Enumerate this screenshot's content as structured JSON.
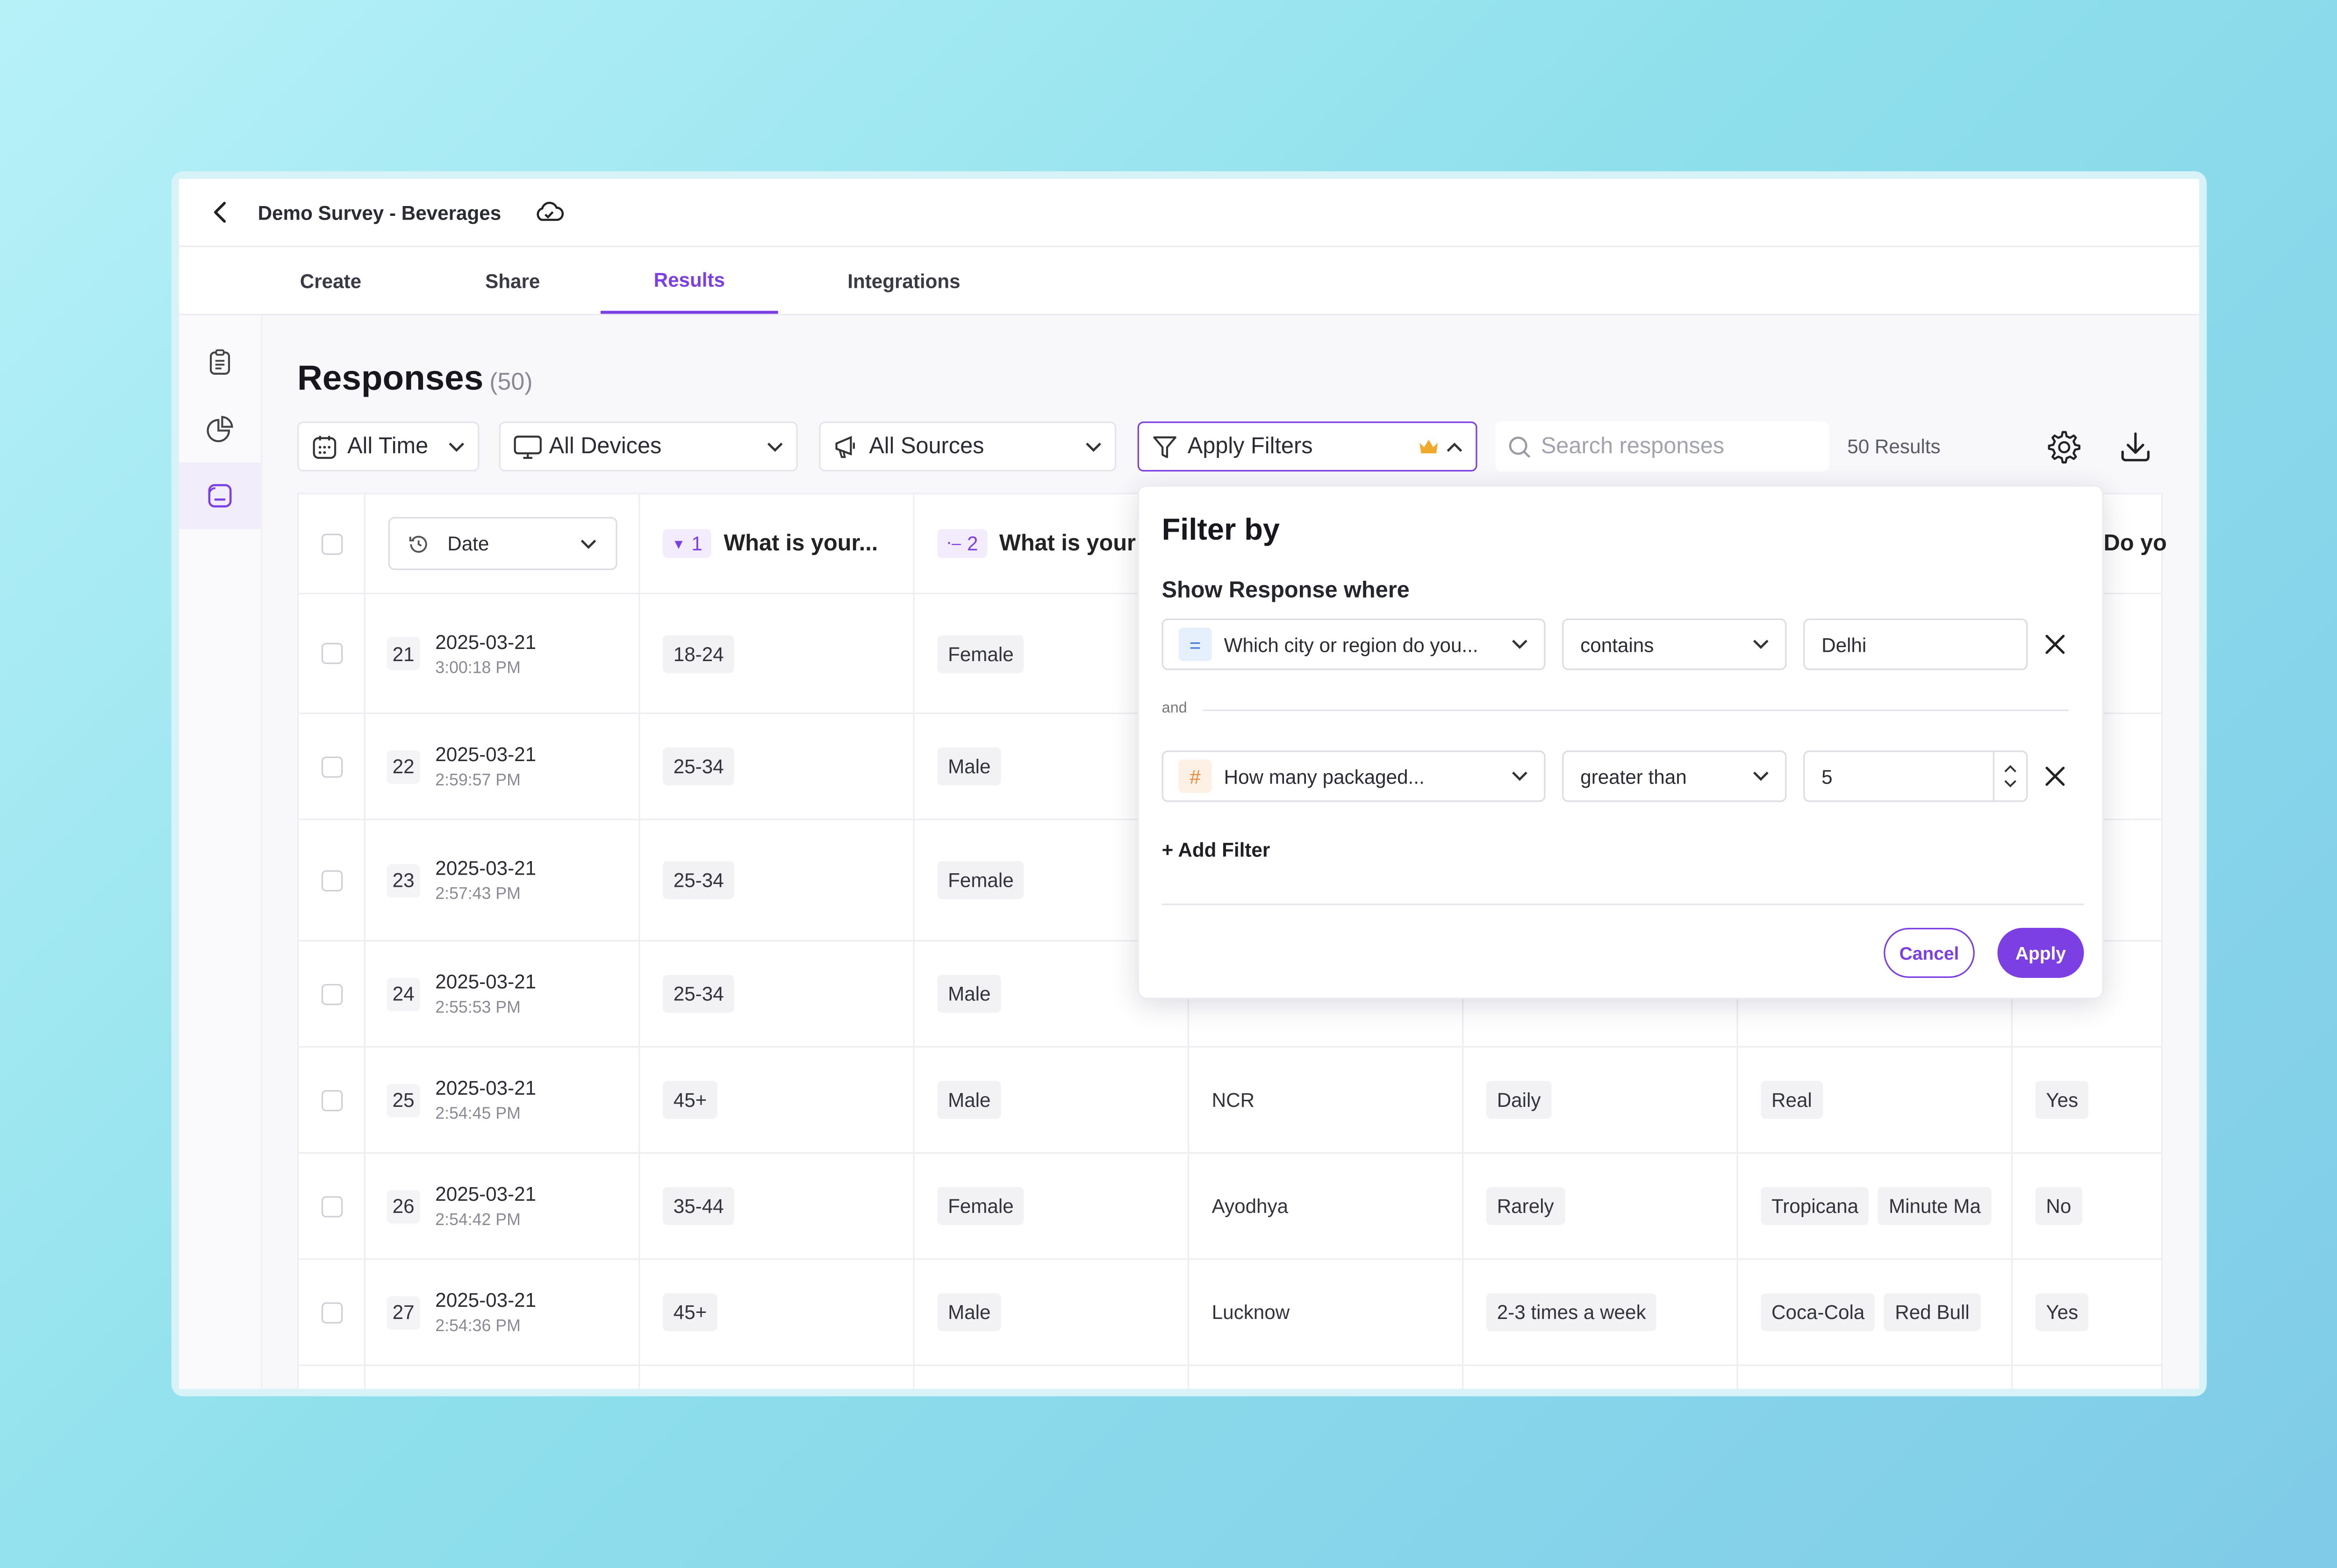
{
  "header": {
    "title": "Demo Survey - Beverages"
  },
  "tabs": [
    {
      "label": "Create"
    },
    {
      "label": "Share"
    },
    {
      "label": "Results"
    },
    {
      "label": "Integrations"
    }
  ],
  "page": {
    "title": "Responses",
    "count": "(50)"
  },
  "toolbar": {
    "time_filter": "All Time",
    "device_filter": "All Devices",
    "source_filter": "All Sources",
    "apply_filters": "Apply Filters",
    "search_placeholder": "Search responses",
    "results": "50 Results"
  },
  "table": {
    "date_column": "Date",
    "col1": {
      "num": "1",
      "label": "What is your..."
    },
    "col2": {
      "num": "2",
      "label": "What is your"
    },
    "col_last": "Do yo",
    "rows": [
      {
        "id": "21",
        "date": "2025-03-21",
        "time": "3:00:18 PM",
        "age": "18-24",
        "gender": "Female"
      },
      {
        "id": "22",
        "date": "2025-03-21",
        "time": "2:59:57 PM",
        "age": "25-34",
        "gender": "Male"
      },
      {
        "id": "23",
        "date": "2025-03-21",
        "time": "2:57:43 PM",
        "age": "25-34",
        "gender": "Female"
      },
      {
        "id": "24",
        "date": "2025-03-21",
        "time": "2:55:53 PM",
        "age": "25-34",
        "gender": "Male"
      },
      {
        "id": "25",
        "date": "2025-03-21",
        "time": "2:54:45 PM",
        "age": "45+",
        "gender": "Male",
        "city": "NCR",
        "freq": "Daily",
        "brand1": "Real",
        "brand2": "",
        "yn": "Yes"
      },
      {
        "id": "26",
        "date": "2025-03-21",
        "time": "2:54:42 PM",
        "age": "35-44",
        "gender": "Female",
        "city": "Ayodhya",
        "freq": "Rarely",
        "brand1": "Tropicana",
        "brand2": "Minute Ma",
        "yn": "No"
      },
      {
        "id": "27",
        "date": "2025-03-21",
        "time": "2:54:36 PM",
        "age": "45+",
        "gender": "Male",
        "city": "Lucknow",
        "freq": "2-3 times a week",
        "brand1": "Coca-Cola",
        "brand2": "Red Bull",
        "yn": "Yes"
      }
    ]
  },
  "filter_popup": {
    "title": "Filter by",
    "subtitle": "Show Response where",
    "filters": [
      {
        "question": "Which city or region do you...",
        "operator": "contains",
        "value": "Delhi"
      },
      {
        "question": "How many packaged...",
        "operator": "greater than",
        "value": "5"
      }
    ],
    "joiner": "and",
    "add_filter": "+ Add Filter",
    "cancel": "Cancel",
    "apply": "Apply"
  },
  "colors": {
    "accent": "#7b3fe4",
    "crown": "#f0a92a",
    "text_icon": "#3d7be0",
    "number_icon": "#e8893a"
  }
}
